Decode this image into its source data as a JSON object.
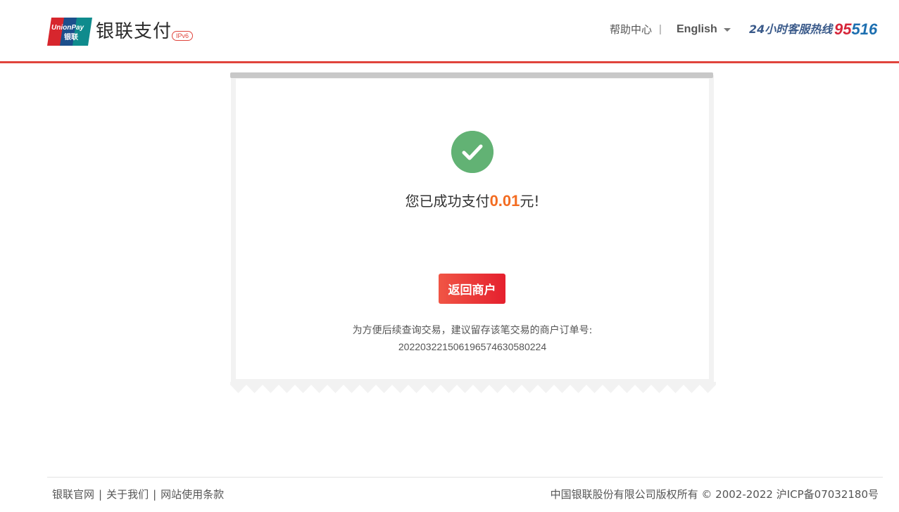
{
  "header": {
    "logo_text_top": "UnionPay",
    "logo_text_bottom": "银联",
    "brand": "银联支付",
    "ipv6_badge": "IPv6",
    "help_center": "帮助中心",
    "separator": "|",
    "language": "English",
    "hotline_label": "24小时客服热线",
    "hotline_number_part1": "95",
    "hotline_number_part2": "516"
  },
  "receipt": {
    "success_prefix": "您已成功支付",
    "amount": "0.01",
    "success_suffix": "元!",
    "back_button": "返回商户",
    "tip": "为方便后续查询交易，建议留存该笔交易的商户订单号:",
    "order_number": "20220322150619657463058022 4"
  },
  "footer": {
    "links": [
      "银联官网",
      "关于我们",
      "网站使用条款"
    ],
    "link_separator": "|",
    "copyright": "中国银联股份有限公司版权所有 © 2002-2022  沪ICP备07032180号"
  },
  "colors": {
    "accent_red": "#e0443c",
    "success_green": "#62b274",
    "amount_orange": "#f36c21"
  }
}
